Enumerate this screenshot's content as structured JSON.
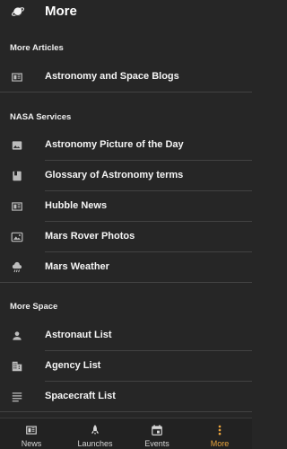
{
  "app_bar": {
    "title": "More"
  },
  "sections": [
    {
      "header": "More Articles",
      "items": [
        {
          "label": "Astronomy and Space Blogs",
          "icon": "newspaper-icon"
        }
      ]
    },
    {
      "header": "NASA Services",
      "items": [
        {
          "label": "Astronomy Picture of the Day",
          "icon": "image-icon"
        },
        {
          "label": "Glossary of Astronomy terms",
          "icon": "book-icon"
        },
        {
          "label": "Hubble News",
          "icon": "newspaper-icon"
        },
        {
          "label": "Mars Rover Photos",
          "icon": "photo-library-icon"
        },
        {
          "label": "Mars Weather",
          "icon": "weather-icon"
        }
      ]
    },
    {
      "header": "More Space",
      "items": [
        {
          "label": "Astronaut List",
          "icon": "person-icon"
        },
        {
          "label": "Agency List",
          "icon": "building-icon"
        },
        {
          "label": "Spacecraft List",
          "icon": "list-icon"
        }
      ]
    }
  ],
  "bottom_nav": {
    "items": [
      {
        "label": "News",
        "icon": "newspaper-icon",
        "active": false
      },
      {
        "label": "Launches",
        "icon": "rocket-icon",
        "active": false
      },
      {
        "label": "Events",
        "icon": "calendar-icon",
        "active": false
      },
      {
        "label": "More",
        "icon": "more-vert-icon",
        "active": true
      }
    ],
    "active_color": "#e8a33d",
    "inactive_color": "#d6d6d6"
  }
}
